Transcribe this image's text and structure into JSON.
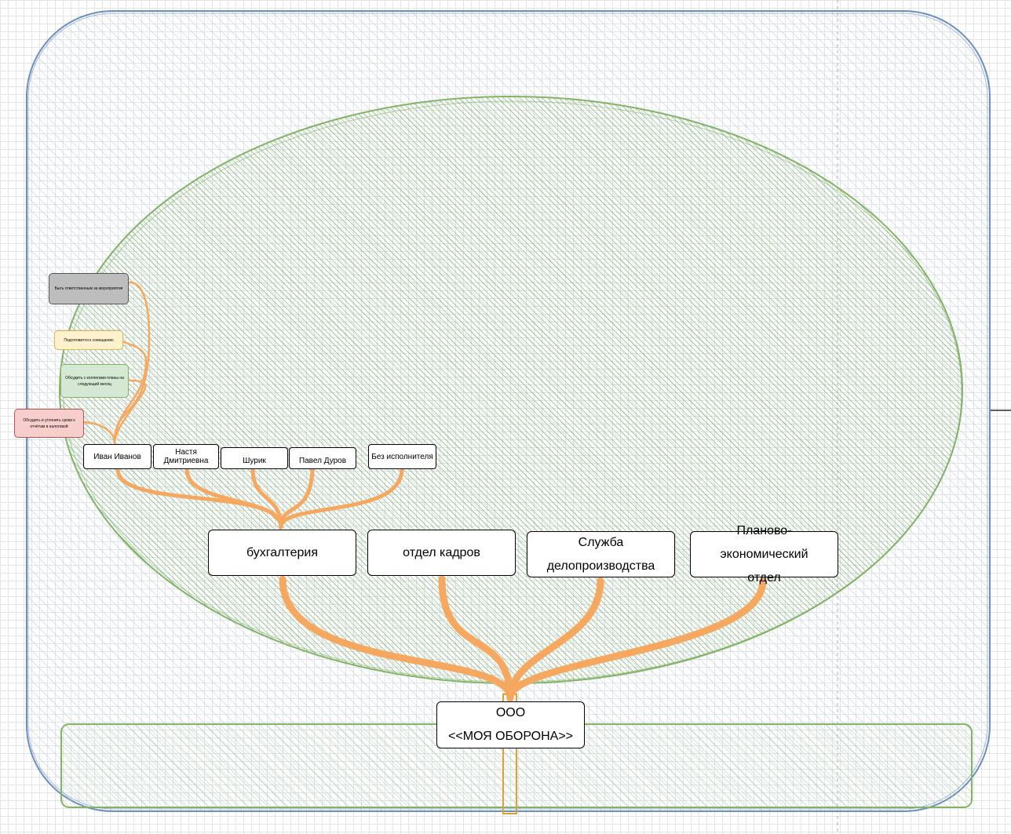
{
  "org": {
    "root_line1": "ООО",
    "root_line2": "<<МОЯ ОБОРОНА>>"
  },
  "departments": [
    {
      "line1": "бухгалтерия",
      "line2": ""
    },
    {
      "line1": "отдел кадров",
      "line2": ""
    },
    {
      "line1": "Служба",
      "line2": "делопроизводства"
    },
    {
      "line1": "Планово-экономический",
      "line2": "отдел"
    }
  ],
  "people": [
    "Иван Иванов",
    "Настя Дмитриевна",
    "Шурик",
    "Павел Дуров",
    "Без исполнителя"
  ],
  "tasks": [
    {
      "text": "Быть ответственным за мероприятия",
      "fill": "#bdbdbd",
      "stroke": "#555555"
    },
    {
      "text": "Подготовится к совещанию",
      "fill": "#fff2cc",
      "stroke": "#d6b656"
    },
    {
      "text": "Обсудить с коллегами планы на следующий месяц",
      "fill": "#d5e8d4",
      "stroke": "#82b366"
    },
    {
      "text": "Обсудить и уточнить сроки к отчётам в налоговой",
      "fill": "#f8cecc",
      "stroke": "#b85450"
    }
  ],
  "colors": {
    "connector": "#f7a860",
    "outer_frame": "#6c8ebf",
    "ellipse": "#82b366",
    "ellipse_hatch": "#6aa84f",
    "base_band": "#82b366"
  }
}
